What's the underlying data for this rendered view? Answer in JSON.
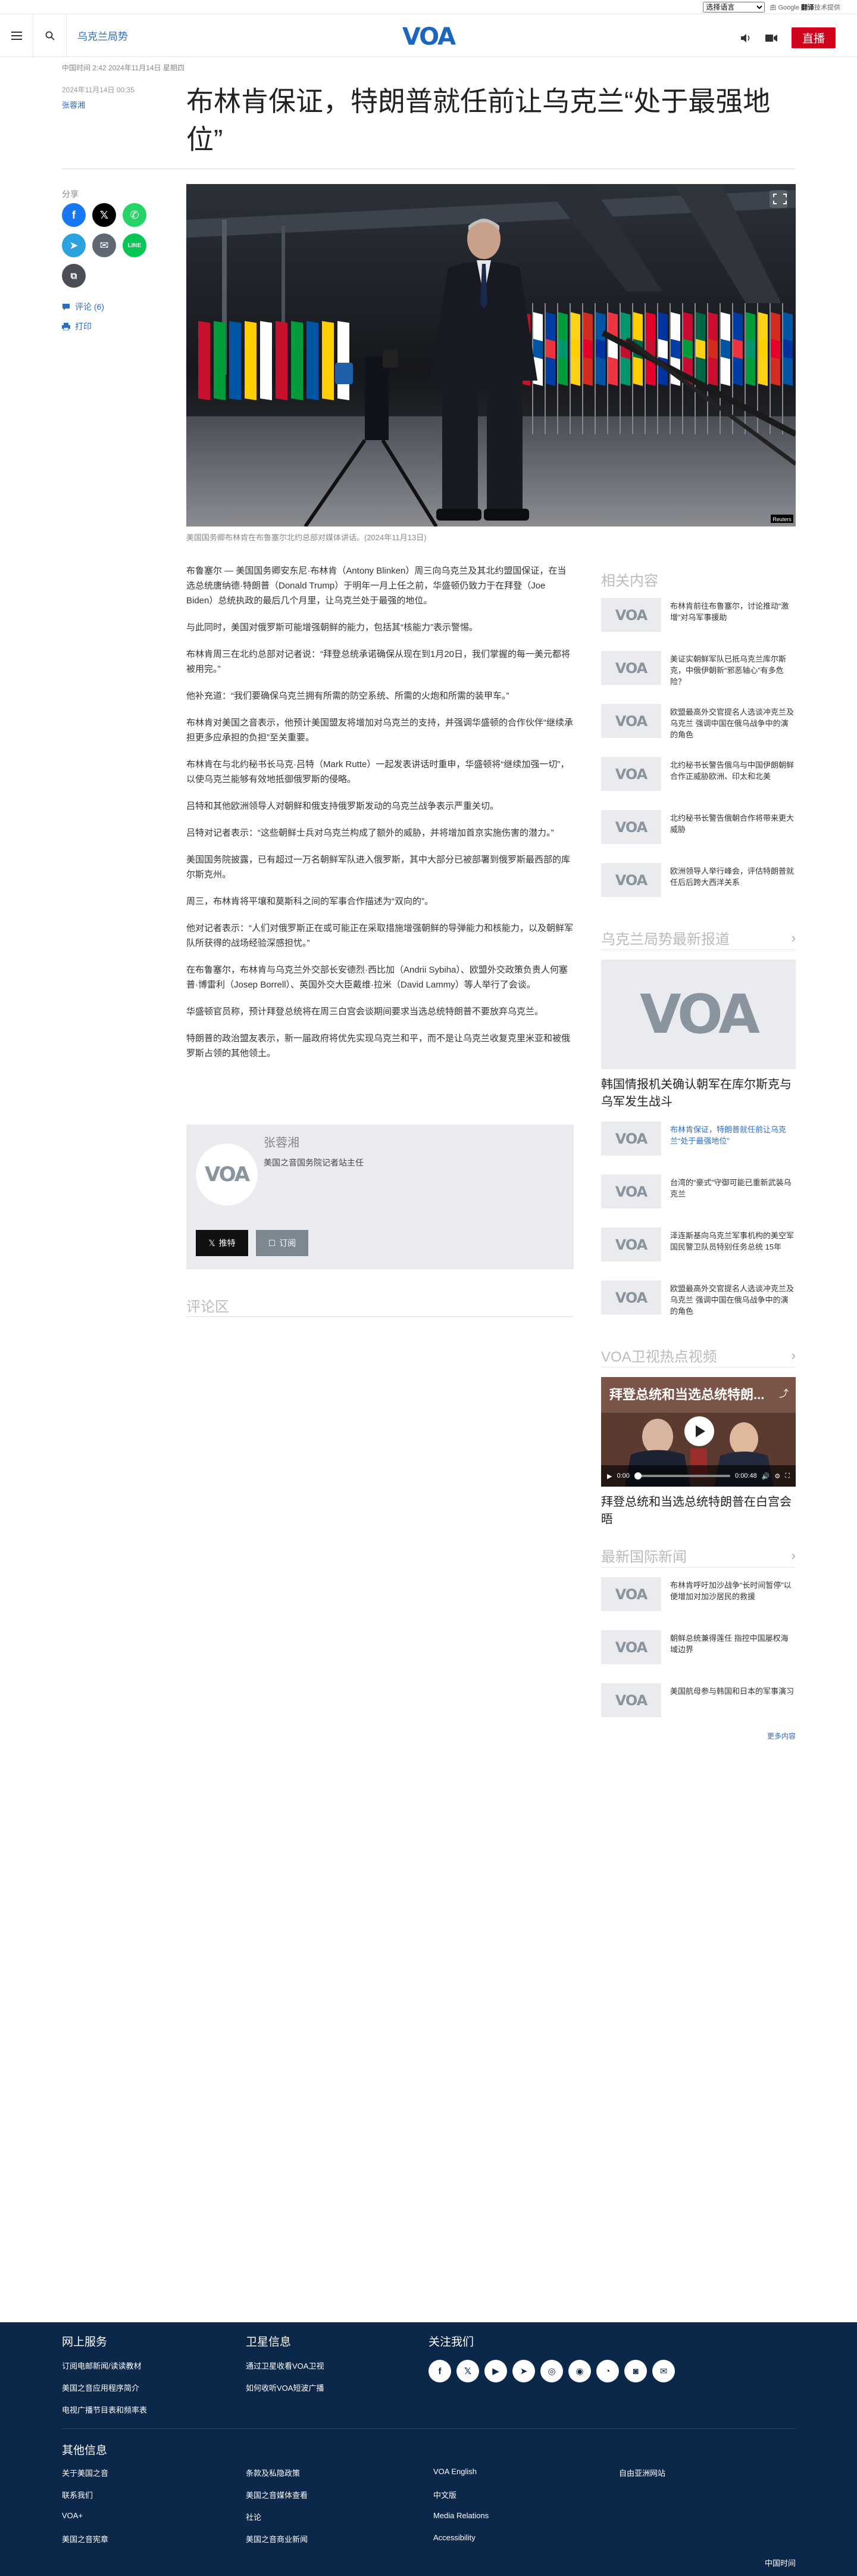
{
  "translate": {
    "select_label": "选择语言",
    "powered": "由 Google",
    "brand": "翻译",
    "powered_suffix": "技术提供"
  },
  "header": {
    "section": "乌克兰局势",
    "logo": "VOA",
    "live": "直播"
  },
  "article": {
    "updated": "中国时间 2:42 2024年11月14日 星期四",
    "date": "2024年11月14日 00:35",
    "author": "张蓉湘",
    "title": "布林肯保证，特朗普就任前让乌克兰“处于最强地位”",
    "caption": "美国国务卿布林肯在布鲁塞尔北约总部对媒体讲话。(2024年11月13日)",
    "photo_credit": "Reuters",
    "paragraphs": [
      "布鲁塞尔 — 美国国务卿安东尼·布林肯（Antony Blinken）周三向乌克兰及其北约盟国保证，在当选总统唐纳德·特朗普（Donald Trump）于明年一月上任之前，华盛顿仍致力于在拜登（Joe Biden）总统执政的最后几个月里，让乌克兰处于最强的地位。",
      "与此同时，美国对俄罗斯可能增强朝鲜的能力，包括其“核能力”表示警惕。",
      "布林肯周三在北约总部对记者说：“拜登总统承诺确保从现在到1月20日，我们掌握的每一美元都将被用完。”",
      "他补充道：“我们要确保乌克兰拥有所需的防空系统、所需的火炮和所需的装甲车。”",
      "布林肯对美国之音表示，他预计美国盟友将增加对乌克兰的支持，并强调华盛顿的合作伙伴“继续承担更多应承担的负担”至关重要。",
      "布林肯在与北约秘书长马克·吕特（Mark Rutte）一起发表讲话时重申，华盛顿将“继续加强一切”，以使乌克兰能够有效地抵御俄罗斯的侵略。",
      "吕特和其他欧洲领导人对朝鲜和俄支持俄罗斯发动的乌克兰战争表示严重关切。",
      "吕特对记者表示：“这些朝鲜士兵对乌克兰构成了额外的威胁，并将增加首京实施伤害的潜力。”",
      "美国国务院披露，已有超过一万名朝鲜军队进入俄罗斯，其中大部分已被部署到俄罗斯最西部的库尔斯克州。",
      "周三，布林肯将平壤和莫斯科之间的军事合作描述为“双向的”。",
      "他对记者表示：“人们对俄罗斯正在或可能正在采取措施增强朝鲜的导弹能力和核能力，以及朝鲜军队所获得的战场经验深感担忧。”",
      "在布鲁塞尔，布林肯与乌克兰外交部长安德烈·西比加（Andrii Sybiha）、欧盟外交政策负责人何塞普·博雷利（Josep Borrell）、英国外交大臣戴维·拉米（David Lammy）等人举行了会谈。",
      "华盛顿官员称，预计拜登总统将在周三白宫会谈期间要求当选总统特朗普不要放弃乌克兰。",
      "特朗普的政治盟友表示，新一届政府将优先实现乌克兰和平，而不是让乌克兰收复克里米亚和被俄罗斯占领的其他领土。"
    ]
  },
  "share": {
    "label": "分享",
    "comments": "评论 (6)",
    "print": "打印"
  },
  "author_box": {
    "name": "张蓉湘",
    "role": "美国之音国务院记者站主任",
    "tweet": "推特",
    "subscribe": "订阅"
  },
  "comments": {
    "title": "评论区"
  },
  "related": {
    "title": "相关内容",
    "items": [
      "布林肯前往布鲁塞尔，讨论推动“激增”对乌军事援助",
      "美证实朝鲜军队已抵乌克兰库尔斯克，中俄伊朝新“邪恶轴心”有多危险？",
      "欧盟最高外交官提名人选谈冲克兰及乌克兰 强调中国在俄乌战争中的演的角色",
      "北约秘书长警告俄乌与中国伊朗朝鲜合作正威胁欧洲、印太和北美",
      "北约秘书长警告俄朝合作将带来更大威胁",
      "欧洲领导人举行峰会，评估特朗普就任后后跨大西洋关系"
    ]
  },
  "latest": {
    "title": "乌克兰局势最新报道",
    "feature_title": "韩国情报机关确认朝军在库尔斯克与乌军发生战斗",
    "items": [
      "布林肯保证，特朗普就任前让乌克兰“处于最强地位”",
      "台湾的“豪式”守御可能已重新武装乌克兰",
      "泽连斯基向乌克兰军事机构的美空军国民警卫队员特别任务总统 15年",
      "欧盟最高外交官提名人选谈冲克兰及乌克兰 强调中国在俄乌战争中的演的角色"
    ]
  },
  "video": {
    "title": "VOA卫视热点视频",
    "overlay": "拜登总统和当选总统特朗...",
    "time": "0:00",
    "duration": "0:00:48",
    "caption": "拜登总统和当选总统特朗普在白宫会晤"
  },
  "world": {
    "title": "最新国际新闻",
    "items": [
      "布林肯呼吁加沙战争“长时间暂停”以便增加对加沙居民的救援",
      "朝鲜总统兼得莲任 指控中国屡权海域边界",
      "美国航母参与韩国和日本的军事演习"
    ],
    "more": "更多内容"
  },
  "footer": {
    "col1_title": "网上服务",
    "col1": [
      "订阅电邮新闻/读读教材",
      "美国之音应用程序简介",
      "电视广播节目表和频率表"
    ],
    "col2_title": "卫星信息",
    "col2": [
      "通过卫星收看VOA卫视",
      "如何收听VOA短波广播"
    ],
    "col3_title": "关注我们",
    "other_title": "其他信息",
    "links_a": [
      "关于美国之音",
      "联系我们",
      "VOA+",
      "美国之音宪章"
    ],
    "links_b": [
      "条款及私隐政策",
      "美国之音媒体查看",
      "社论",
      "美国之音商业新闻"
    ],
    "links_c": [
      "VOA English",
      "中文版",
      "Media Relations",
      "Accessibility"
    ],
    "links_d": [
      "自由亚洲网站"
    ],
    "time": "中国时间"
  },
  "colors": {
    "brand_blue": "#1c66c0",
    "link_blue": "#2a6cc3",
    "live_red": "#d0021b",
    "footer_navy": "#0b2749"
  }
}
